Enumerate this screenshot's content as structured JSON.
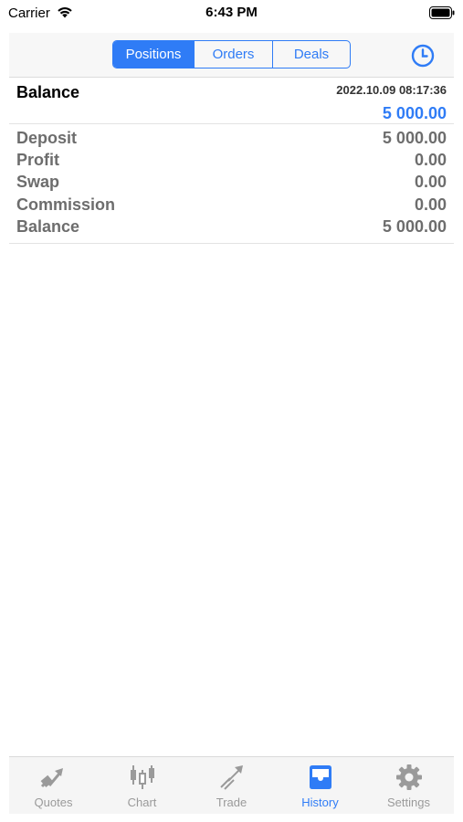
{
  "status_bar": {
    "carrier": "Carrier",
    "time": "6:43 PM"
  },
  "tabs": [
    {
      "label": "Positions",
      "active": true
    },
    {
      "label": "Orders",
      "active": false
    },
    {
      "label": "Deals",
      "active": false
    }
  ],
  "header": {
    "right_icon": "clock-icon"
  },
  "balance_entry": {
    "title": "Balance",
    "datetime": "2022.10.09 08:17:36",
    "amount": "5 000.00"
  },
  "summary": [
    {
      "label": "Deposit",
      "value": "5 000.00"
    },
    {
      "label": "Profit",
      "value": "0.00"
    },
    {
      "label": "Swap",
      "value": "0.00"
    },
    {
      "label": "Commission",
      "value": "0.00"
    },
    {
      "label": "Balance",
      "value": "5 000.00"
    }
  ],
  "tab_bar": [
    {
      "label": "Quotes",
      "icon": "quotes-arrow-icon",
      "active": false
    },
    {
      "label": "Chart",
      "icon": "candlestick-icon",
      "active": false
    },
    {
      "label": "Trade",
      "icon": "trade-arrow-icon",
      "active": false
    },
    {
      "label": "History",
      "icon": "inbox-tray-icon",
      "active": true
    },
    {
      "label": "Settings",
      "icon": "gear-icon",
      "active": false
    }
  ],
  "colors": {
    "accent": "#2f7cf6",
    "muted": "#6d6d6d",
    "inactive": "#9a9a9a"
  }
}
